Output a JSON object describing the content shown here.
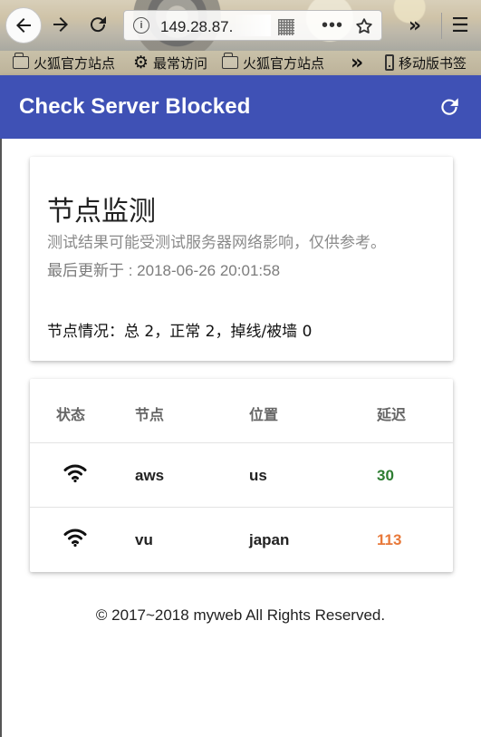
{
  "browser": {
    "address": "149.28.87.",
    "bookmarks": [
      "火狐官方站点",
      "最常访问",
      "火狐官方站点",
      "移动版书签"
    ]
  },
  "app": {
    "title": "Check Server Blocked"
  },
  "summary": {
    "title": "节点监测",
    "subtitle": "测试结果可能受测试服务器网络影响，仅供参考。",
    "updated_label": "最后更新于 : ",
    "updated_value": "2018-06-26 20:01:58",
    "stats": "节点情况：总 2，正常 2，掉线/被墙 0"
  },
  "table": {
    "headers": {
      "status": "状态",
      "node": "节点",
      "location": "位置",
      "latency": "延迟"
    },
    "rows": [
      {
        "status_icon": "wifi-icon",
        "node": "aws",
        "location": "us",
        "latency": "30",
        "latency_color": "#2e7d32"
      },
      {
        "status_icon": "wifi-icon",
        "node": "vu",
        "location": "japan",
        "latency": "113",
        "latency_color": "#e8793a"
      }
    ]
  },
  "footer": {
    "text": "© 2017~2018 myweb All Rights Reserved."
  },
  "colors": {
    "app_bar": "#3f51b5",
    "title_text": "#ffffff",
    "muted_text": "#8a8a8a"
  }
}
